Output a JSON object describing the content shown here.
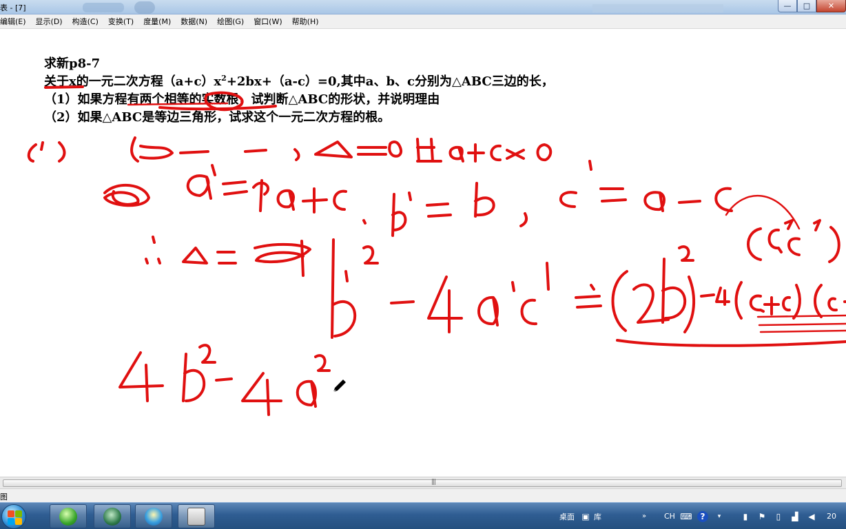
{
  "window": {
    "title": "表 - [7]",
    "buttons": {
      "minimize": "—",
      "maximize": "□",
      "close": "✕"
    }
  },
  "menubar": {
    "items": [
      "编辑(E)",
      "显示(D)",
      "构造(C)",
      "变换(T)",
      "度量(M)",
      "数据(N)",
      "绘图(G)",
      "窗口(W)",
      "帮助(H)"
    ]
  },
  "document": {
    "title": "求新p8-7",
    "line1_pre": "关于x的一元二次方程（a+c）x",
    "line1_sup": "2",
    "line1_post": "+2bx+（a-c）=0,其中a、b、c分别为△ABC三边的长，",
    "line2": "（1）如果方程有两个相等的实数根，试判断△ABC的形状，并说明理由",
    "line3": "（2）如果△ABC是等边三角形，试求这个一元二次方程的根。"
  },
  "ink": {
    "color": "#e01010"
  },
  "hscroll": {
    "grip": "|||"
  },
  "statusbar": {
    "text": "图"
  },
  "taskbar": {
    "tray_desktop": "桌面",
    "tray_library": "库",
    "tray_lang": "CH",
    "tray_clock": "20"
  },
  "icons": {
    "start": "windows-start-orb",
    "task1": "browser-green-icon",
    "task2": "globe-tool-icon",
    "task3": "water-drop-icon",
    "task4": "sketchpad-app-icon",
    "pen": "pen-cursor-icon"
  }
}
